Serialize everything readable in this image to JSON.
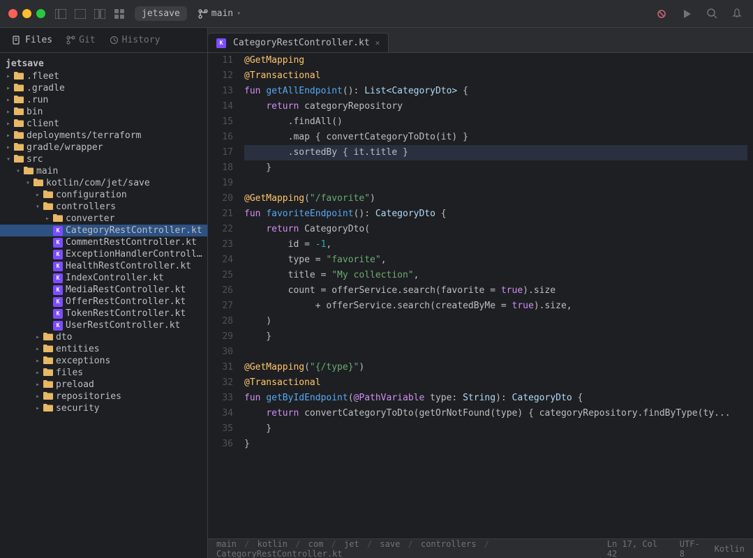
{
  "titlebar": {
    "project": "jetsave",
    "branch": "main",
    "branch_icon": "⎇",
    "icons": {
      "sidebar_icon": "▣",
      "layout1": "▭",
      "layout2": "▯",
      "grid": "⊞",
      "record_icon": "⏺",
      "run_icon": "▶",
      "search_icon": "🔍",
      "bell_icon": "🔔"
    }
  },
  "sidebar": {
    "tabs": [
      {
        "id": "files",
        "label": "Files",
        "icon": "📄"
      },
      {
        "id": "git",
        "label": "Git",
        "icon": "⎇"
      },
      {
        "id": "history",
        "label": "History",
        "icon": "🕐"
      }
    ],
    "root": "jetsave",
    "tree": [
      {
        "id": "fleet",
        "label": ".fleet",
        "type": "folder",
        "depth": 0,
        "expanded": false
      },
      {
        "id": "gradle",
        "label": ".gradle",
        "type": "folder",
        "depth": 0,
        "expanded": false
      },
      {
        "id": "run",
        "label": ".run",
        "type": "folder",
        "depth": 0,
        "expanded": false
      },
      {
        "id": "bin",
        "label": "bin",
        "type": "folder",
        "depth": 0,
        "expanded": false
      },
      {
        "id": "client",
        "label": "client",
        "type": "folder",
        "depth": 0,
        "expanded": false
      },
      {
        "id": "deployments",
        "label": "deployments/terraform",
        "type": "folder",
        "depth": 0,
        "expanded": false
      },
      {
        "id": "gradle_wrapper",
        "label": "gradle/wrapper",
        "type": "folder",
        "depth": 0,
        "expanded": false
      },
      {
        "id": "src",
        "label": "src",
        "type": "folder",
        "depth": 0,
        "expanded": true
      },
      {
        "id": "main",
        "label": "main",
        "type": "folder",
        "depth": 1,
        "expanded": true
      },
      {
        "id": "kotlin_com_jet_save",
        "label": "kotlin/com/jet/save",
        "type": "folder",
        "depth": 2,
        "expanded": true
      },
      {
        "id": "configuration",
        "label": "configuration",
        "type": "folder",
        "depth": 3,
        "expanded": false
      },
      {
        "id": "controllers",
        "label": "controllers",
        "type": "folder",
        "depth": 3,
        "expanded": true
      },
      {
        "id": "converter",
        "label": "converter",
        "type": "folder",
        "depth": 4,
        "expanded": false
      },
      {
        "id": "CategoryRestController",
        "label": "CategoryRestController.kt",
        "type": "kt",
        "depth": 4,
        "selected": true
      },
      {
        "id": "CommentRestController",
        "label": "CommentRestController.kt",
        "type": "kt",
        "depth": 4
      },
      {
        "id": "ExceptionHandlerController",
        "label": "ExceptionHandlerControlle...",
        "type": "kt",
        "depth": 4
      },
      {
        "id": "HealthRestController",
        "label": "HealthRestController.kt",
        "type": "kt",
        "depth": 4
      },
      {
        "id": "IndexController",
        "label": "IndexController.kt",
        "type": "kt",
        "depth": 4
      },
      {
        "id": "MediaRestController",
        "label": "MediaRestController.kt",
        "type": "kt",
        "depth": 4
      },
      {
        "id": "OfferRestController",
        "label": "OfferRestController.kt",
        "type": "kt",
        "depth": 4
      },
      {
        "id": "TokenRestController",
        "label": "TokenRestController.kt",
        "type": "kt",
        "depth": 4
      },
      {
        "id": "UserRestController",
        "label": "UserRestController.kt",
        "type": "kt",
        "depth": 4
      },
      {
        "id": "dto",
        "label": "dto",
        "type": "folder",
        "depth": 3,
        "expanded": false
      },
      {
        "id": "entities",
        "label": "entities",
        "type": "folder",
        "depth": 3,
        "expanded": false
      },
      {
        "id": "exceptions",
        "label": "exceptions",
        "type": "folder",
        "depth": 3,
        "expanded": false
      },
      {
        "id": "files",
        "label": "files",
        "type": "folder",
        "depth": 3,
        "expanded": false
      },
      {
        "id": "preload",
        "label": "preload",
        "type": "folder",
        "depth": 3,
        "expanded": false
      },
      {
        "id": "repositories",
        "label": "repositories",
        "type": "folder",
        "depth": 3,
        "expanded": false
      },
      {
        "id": "security",
        "label": "security",
        "type": "folder",
        "depth": 3,
        "expanded": false
      }
    ]
  },
  "editor": {
    "tab": {
      "icon": "K",
      "label": "CategoryRestController.kt"
    },
    "lines": [
      {
        "num": "11",
        "tokens": [
          {
            "t": "annotation",
            "v": "@GetMapping"
          }
        ]
      },
      {
        "num": "12",
        "tokens": [
          {
            "t": "annotation",
            "v": "@Transactional"
          }
        ]
      },
      {
        "num": "13",
        "tokens": [
          {
            "t": "keyword",
            "v": "fun "
          },
          {
            "t": "function",
            "v": "getAllEndpoint"
          },
          {
            "t": "plain",
            "v": "(): "
          },
          {
            "t": "type",
            "v": "List<CategoryDto>"
          },
          {
            "t": "plain",
            "v": " {"
          }
        ]
      },
      {
        "num": "14",
        "tokens": [
          {
            "t": "plain",
            "v": "    "
          },
          {
            "t": "keyword",
            "v": "return"
          },
          {
            "t": "plain",
            "v": " categoryRepository"
          }
        ]
      },
      {
        "num": "15",
        "tokens": [
          {
            "t": "plain",
            "v": "        .findAll()"
          }
        ]
      },
      {
        "num": "16",
        "tokens": [
          {
            "t": "plain",
            "v": "        .map { convertCategoryToDto(it) }"
          }
        ]
      },
      {
        "num": "17",
        "tokens": [
          {
            "t": "plain",
            "v": "        .sortedBy { it.title }"
          }
        ],
        "highlighted": true
      },
      {
        "num": "18",
        "tokens": [
          {
            "t": "plain",
            "v": "    }"
          }
        ]
      },
      {
        "num": "19",
        "tokens": []
      },
      {
        "num": "20",
        "tokens": [
          {
            "t": "annotation",
            "v": "@GetMapping"
          },
          {
            "t": "plain",
            "v": "("
          },
          {
            "t": "string",
            "v": "\"/favorite\""
          },
          {
            "t": "plain",
            "v": ")"
          }
        ]
      },
      {
        "num": "21",
        "tokens": [
          {
            "t": "keyword",
            "v": "fun "
          },
          {
            "t": "function",
            "v": "favoriteEndpoint"
          },
          {
            "t": "plain",
            "v": "(): "
          },
          {
            "t": "type",
            "v": "CategoryDto"
          },
          {
            "t": "plain",
            "v": " {"
          }
        ]
      },
      {
        "num": "22",
        "tokens": [
          {
            "t": "plain",
            "v": "    "
          },
          {
            "t": "keyword",
            "v": "return"
          },
          {
            "t": "plain",
            "v": " CategoryDto("
          }
        ]
      },
      {
        "num": "23",
        "tokens": [
          {
            "t": "plain",
            "v": "        id = "
          },
          {
            "t": "number",
            "v": "-1"
          },
          {
            "t": "plain",
            "v": ","
          }
        ]
      },
      {
        "num": "24",
        "tokens": [
          {
            "t": "plain",
            "v": "        type = "
          },
          {
            "t": "string",
            "v": "\"favorite\""
          },
          {
            "t": "plain",
            "v": ","
          }
        ]
      },
      {
        "num": "25",
        "tokens": [
          {
            "t": "plain",
            "v": "        title = "
          },
          {
            "t": "string",
            "v": "\"My collection\""
          },
          {
            "t": "plain",
            "v": ","
          }
        ]
      },
      {
        "num": "26",
        "tokens": [
          {
            "t": "plain",
            "v": "        count = offerService.search(favorite = "
          },
          {
            "t": "keyword",
            "v": "true"
          },
          {
            "t": "plain",
            "v": ").size"
          }
        ]
      },
      {
        "num": "27",
        "tokens": [
          {
            "t": "plain",
            "v": "             + offerService.search(createdByMe = "
          },
          {
            "t": "keyword",
            "v": "true"
          },
          {
            "t": "plain",
            "v": ").size,"
          }
        ]
      },
      {
        "num": "28",
        "tokens": [
          {
            "t": "plain",
            "v": "    )"
          }
        ]
      },
      {
        "num": "29",
        "tokens": [
          {
            "t": "plain",
            "v": "    }"
          }
        ]
      },
      {
        "num": "30",
        "tokens": []
      },
      {
        "num": "31",
        "tokens": [
          {
            "t": "annotation",
            "v": "@GetMapping"
          },
          {
            "t": "plain",
            "v": "("
          },
          {
            "t": "string",
            "v": "\"{/type}\""
          },
          {
            "t": "plain",
            "v": ")"
          }
        ]
      },
      {
        "num": "32",
        "tokens": [
          {
            "t": "annotation",
            "v": "@Transactional"
          }
        ]
      },
      {
        "num": "33",
        "tokens": [
          {
            "t": "keyword",
            "v": "fun "
          },
          {
            "t": "function",
            "v": "getByIdEndpoint"
          },
          {
            "t": "plain",
            "v": "("
          },
          {
            "t": "param",
            "v": "@PathVariable"
          },
          {
            "t": "plain",
            "v": " type: "
          },
          {
            "t": "type",
            "v": "String"
          },
          {
            "t": "plain",
            "v": "): "
          },
          {
            "t": "type",
            "v": "CategoryDto"
          },
          {
            "t": "plain",
            "v": " {"
          }
        ]
      },
      {
        "num": "34",
        "tokens": [
          {
            "t": "plain",
            "v": "    "
          },
          {
            "t": "keyword",
            "v": "return"
          },
          {
            "t": "plain",
            "v": " convertCategoryToDto(getOrNotFound(type) { categoryRepository.findByType(ty..."
          }
        ]
      },
      {
        "num": "35",
        "tokens": [
          {
            "t": "plain",
            "v": "    }"
          }
        ]
      },
      {
        "num": "36",
        "tokens": [
          {
            "t": "plain",
            "v": "}"
          }
        ]
      }
    ]
  },
  "statusbar": {
    "breadcrumb": [
      "main",
      "kotlin",
      "com",
      "jet",
      "save",
      "controllers",
      "CategoryRestController.kt"
    ],
    "position": "Ln 17, Col 42",
    "encoding": "UTF-8",
    "language": "Kotlin"
  }
}
